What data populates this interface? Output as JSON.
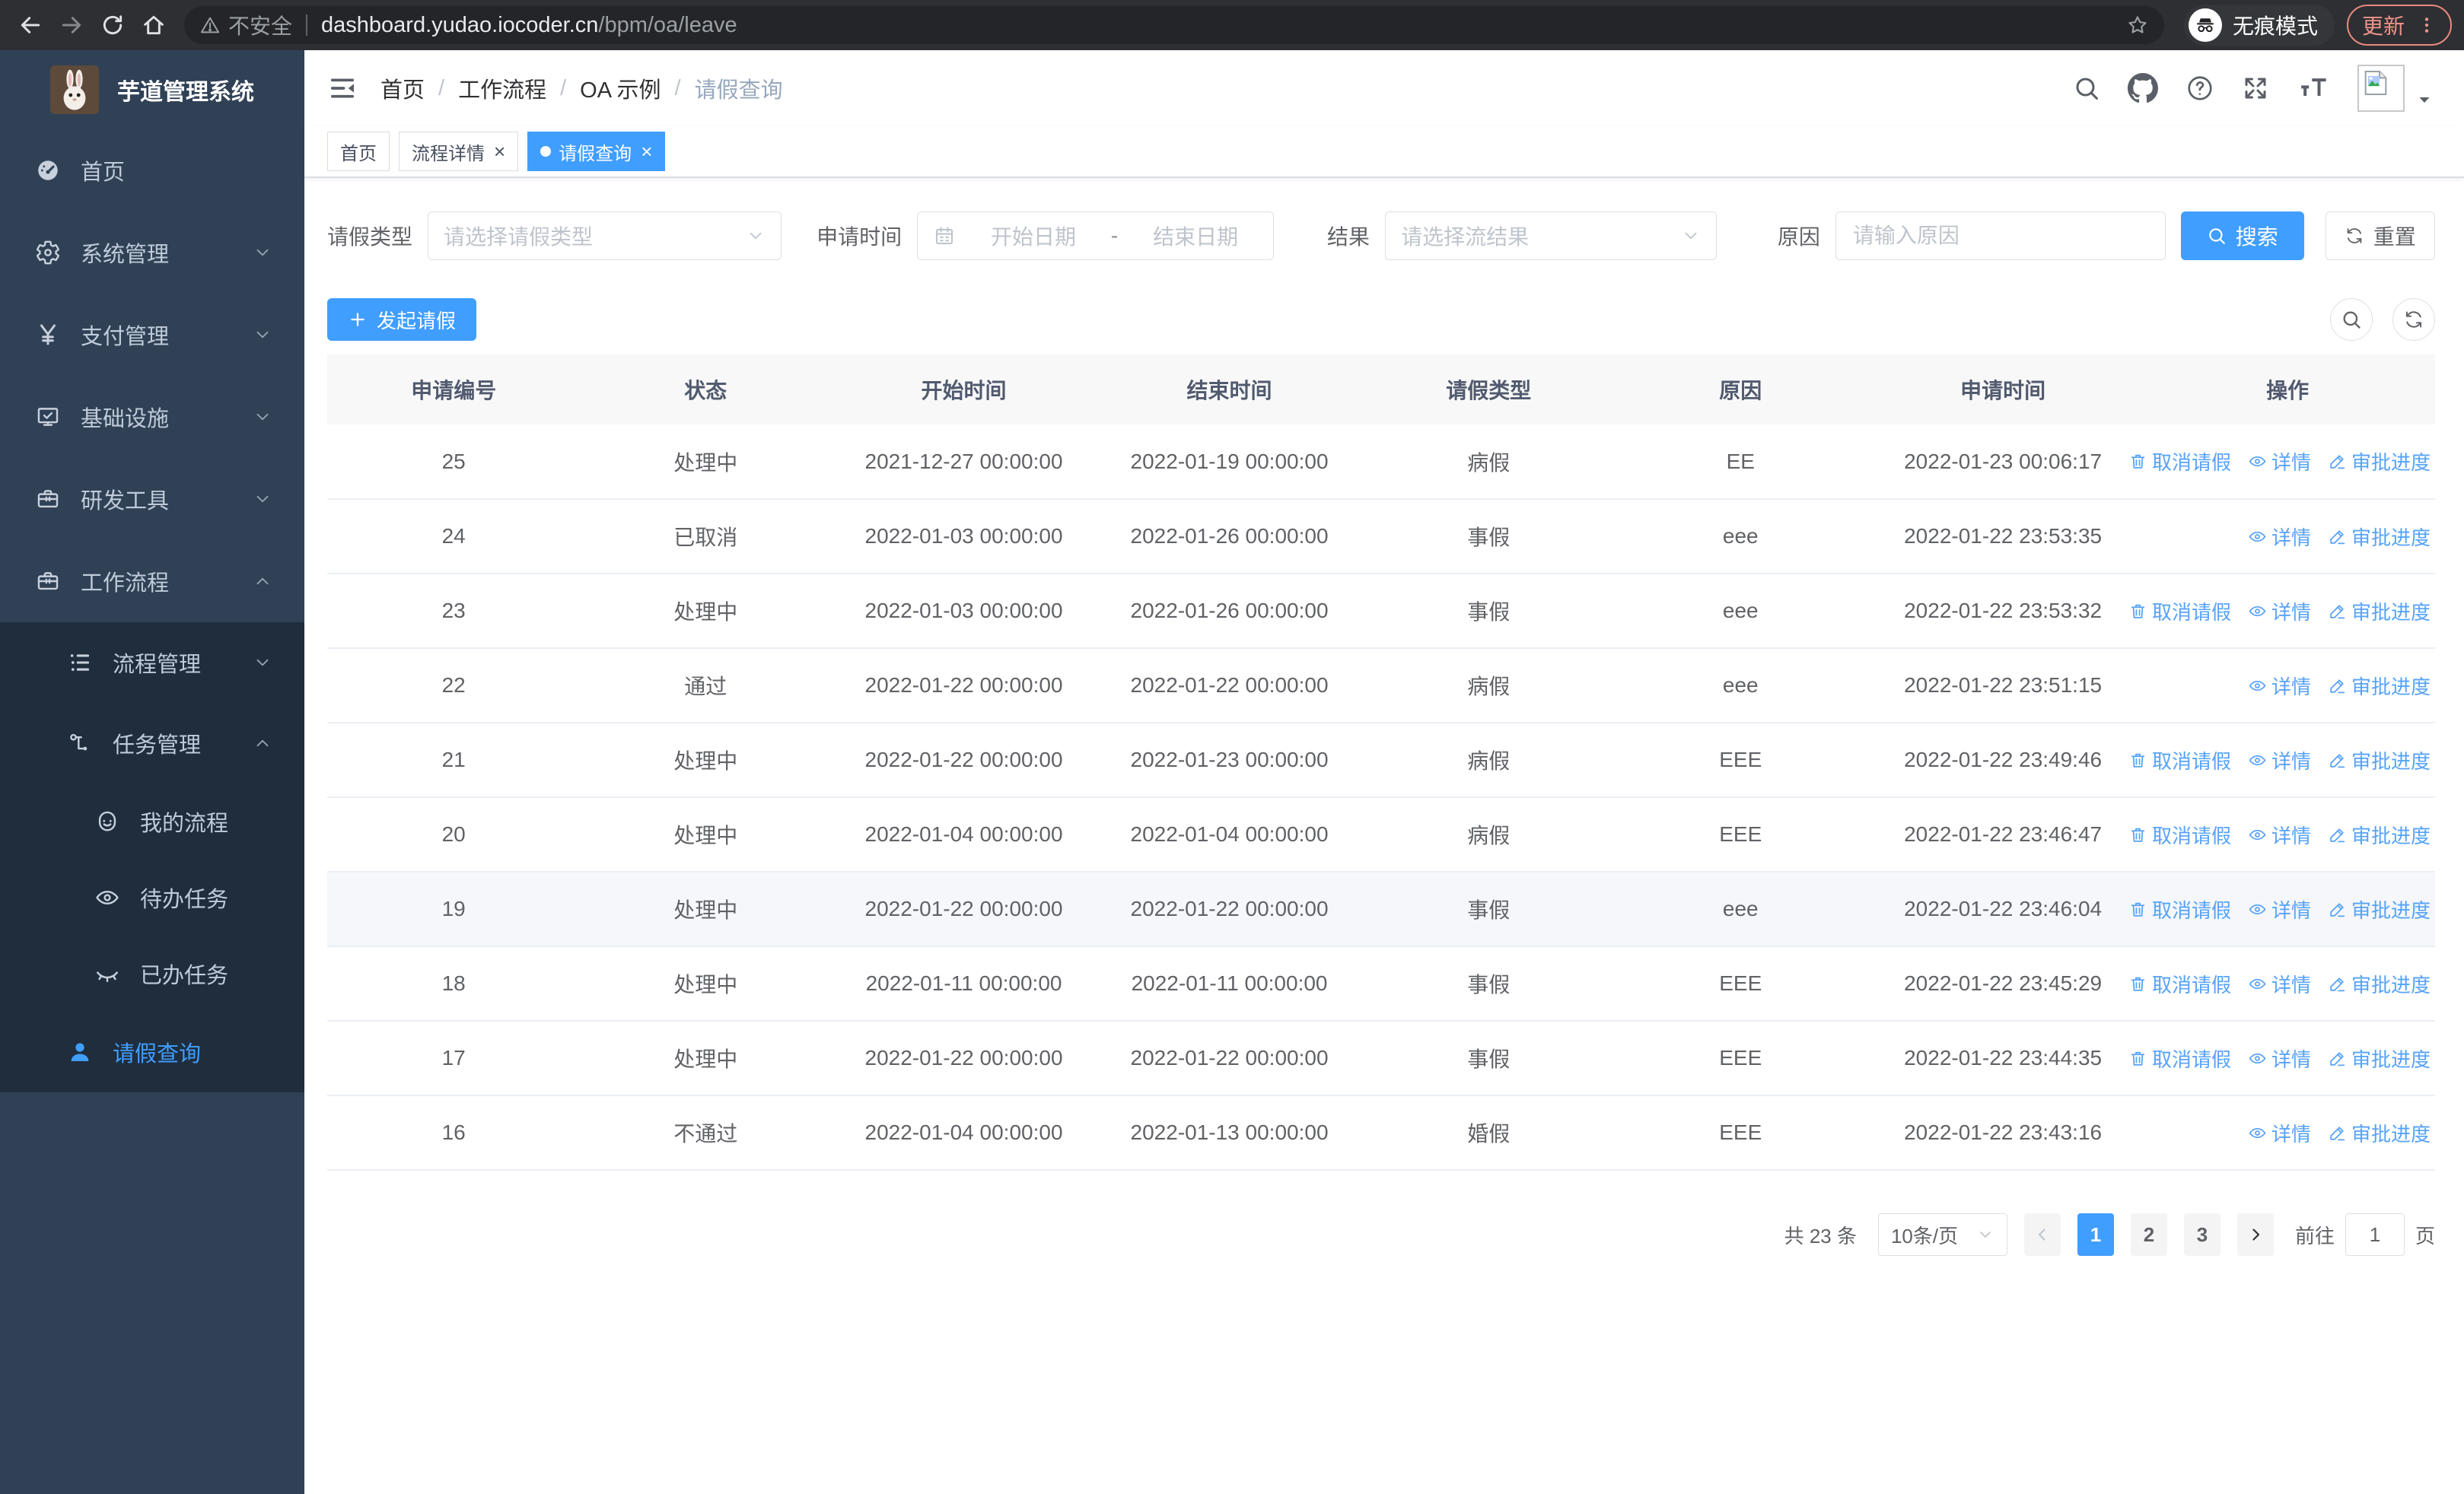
{
  "browser": {
    "security_label": "不安全",
    "url_host": "dashboard.yudao.iocoder.cn",
    "url_path": "/bpm/oa/leave",
    "incognito_label": "无痕模式",
    "update_label": "更新"
  },
  "sidebar": {
    "logo_title": "芋道管理系统",
    "items": [
      {
        "label": "首页",
        "icon": "dashboard-icon",
        "level": "top",
        "expandable": false,
        "expanded": false,
        "active": false
      },
      {
        "label": "系统管理",
        "icon": "gear-icon",
        "level": "top",
        "expandable": true,
        "expanded": false,
        "active": false
      },
      {
        "label": "支付管理",
        "icon": "yen-icon",
        "level": "top",
        "expandable": true,
        "expanded": false,
        "active": false
      },
      {
        "label": "基础设施",
        "icon": "monitor-icon",
        "level": "top",
        "expandable": true,
        "expanded": false,
        "active": false
      },
      {
        "label": "研发工具",
        "icon": "toolbox-icon",
        "level": "top",
        "expandable": true,
        "expanded": false,
        "active": false
      },
      {
        "label": "工作流程",
        "icon": "toolbox-icon",
        "level": "top",
        "expandable": true,
        "expanded": true,
        "active": false
      },
      {
        "label": "流程管理",
        "icon": "tree-list-icon",
        "level": "sub1",
        "expandable": true,
        "expanded": false,
        "active": false
      },
      {
        "label": "任务管理",
        "icon": "org-tree-icon",
        "level": "sub1",
        "expandable": true,
        "expanded": true,
        "active": false
      },
      {
        "label": "我的流程",
        "icon": "face-icon",
        "level": "sub2",
        "expandable": false,
        "expanded": false,
        "active": false
      },
      {
        "label": "待办任务",
        "icon": "eye-open-icon",
        "level": "sub2",
        "expandable": false,
        "expanded": false,
        "active": false
      },
      {
        "label": "已办任务",
        "icon": "eye-closed-icon",
        "level": "sub2",
        "expandable": false,
        "expanded": false,
        "active": false
      },
      {
        "label": "请假查询",
        "icon": "person-icon",
        "level": "sub1",
        "expandable": false,
        "expanded": false,
        "active": true
      }
    ]
  },
  "navbar": {
    "breadcrumbs": [
      "首页",
      "工作流程",
      "OA 示例",
      "请假查询"
    ]
  },
  "tabs": [
    {
      "label": "首页",
      "closable": false,
      "active": false
    },
    {
      "label": "流程详情",
      "closable": true,
      "active": false
    },
    {
      "label": "请假查询",
      "closable": true,
      "active": true
    }
  ],
  "filters": {
    "leave_type_label": "请假类型",
    "leave_type_placeholder": "请选择请假类型",
    "apply_time_label": "申请时间",
    "date_start_placeholder": "开始日期",
    "date_separator": "-",
    "date_end_placeholder": "结束日期",
    "result_label": "结果",
    "result_placeholder": "请选择流结果",
    "reason_label": "原因",
    "reason_placeholder": "请输入原因",
    "search_label": "搜索",
    "reset_label": "重置"
  },
  "toolbar": {
    "create_label": "发起请假"
  },
  "table": {
    "headers": [
      "申请编号",
      "状态",
      "开始时间",
      "结束时间",
      "请假类型",
      "原因",
      "申请时间",
      "操作"
    ],
    "action_defs": {
      "cancel": {
        "label": "取消请假",
        "icon": "trash-icon"
      },
      "detail": {
        "label": "详情",
        "icon": "eye-sm-icon"
      },
      "progress": {
        "label": "审批进度",
        "icon": "pen-icon"
      }
    },
    "rows": [
      {
        "id": "25",
        "status": "处理中",
        "start": "2021-12-27 00:00:00",
        "end": "2022-01-19 00:00:00",
        "type": "病假",
        "reason": "EE",
        "applied": "2022-01-23 00:06:17",
        "actions": [
          "cancel",
          "detail",
          "progress"
        ],
        "highlight": false
      },
      {
        "id": "24",
        "status": "已取消",
        "start": "2022-01-03 00:00:00",
        "end": "2022-01-26 00:00:00",
        "type": "事假",
        "reason": "eee",
        "applied": "2022-01-22 23:53:35",
        "actions": [
          "detail",
          "progress"
        ],
        "highlight": false
      },
      {
        "id": "23",
        "status": "处理中",
        "start": "2022-01-03 00:00:00",
        "end": "2022-01-26 00:00:00",
        "type": "事假",
        "reason": "eee",
        "applied": "2022-01-22 23:53:32",
        "actions": [
          "cancel",
          "detail",
          "progress"
        ],
        "highlight": false
      },
      {
        "id": "22",
        "status": "通过",
        "start": "2022-01-22 00:00:00",
        "end": "2022-01-22 00:00:00",
        "type": "病假",
        "reason": "eee",
        "applied": "2022-01-22 23:51:15",
        "actions": [
          "detail",
          "progress"
        ],
        "highlight": false
      },
      {
        "id": "21",
        "status": "处理中",
        "start": "2022-01-22 00:00:00",
        "end": "2022-01-23 00:00:00",
        "type": "病假",
        "reason": "EEE",
        "applied": "2022-01-22 23:49:46",
        "actions": [
          "cancel",
          "detail",
          "progress"
        ],
        "highlight": false
      },
      {
        "id": "20",
        "status": "处理中",
        "start": "2022-01-04 00:00:00",
        "end": "2022-01-04 00:00:00",
        "type": "病假",
        "reason": "EEE",
        "applied": "2022-01-22 23:46:47",
        "actions": [
          "cancel",
          "detail",
          "progress"
        ],
        "highlight": false
      },
      {
        "id": "19",
        "status": "处理中",
        "start": "2022-01-22 00:00:00",
        "end": "2022-01-22 00:00:00",
        "type": "事假",
        "reason": "eee",
        "applied": "2022-01-22 23:46:04",
        "actions": [
          "cancel",
          "detail",
          "progress"
        ],
        "highlight": true
      },
      {
        "id": "18",
        "status": "处理中",
        "start": "2022-01-11 00:00:00",
        "end": "2022-01-11 00:00:00",
        "type": "事假",
        "reason": "EEE",
        "applied": "2022-01-22 23:45:29",
        "actions": [
          "cancel",
          "detail",
          "progress"
        ],
        "highlight": false
      },
      {
        "id": "17",
        "status": "处理中",
        "start": "2022-01-22 00:00:00",
        "end": "2022-01-22 00:00:00",
        "type": "事假",
        "reason": "EEE",
        "applied": "2022-01-22 23:44:35",
        "actions": [
          "cancel",
          "detail",
          "progress"
        ],
        "highlight": false
      },
      {
        "id": "16",
        "status": "不通过",
        "start": "2022-01-04 00:00:00",
        "end": "2022-01-13 00:00:00",
        "type": "婚假",
        "reason": "EEE",
        "applied": "2022-01-22 23:43:16",
        "actions": [
          "detail",
          "progress"
        ],
        "highlight": false
      }
    ]
  },
  "pagination": {
    "total_label": "共 23 条",
    "page_size": "10条/页",
    "pages": [
      "1",
      "2",
      "3"
    ],
    "active_page": "1",
    "goto_label": "前往",
    "goto_value": "1",
    "page_unit": "页"
  },
  "colors": {
    "accent": "#409eff",
    "sidebar_bg": "#304156",
    "submenu_bg": "#1f2d3d",
    "link": "#57a3f9"
  }
}
